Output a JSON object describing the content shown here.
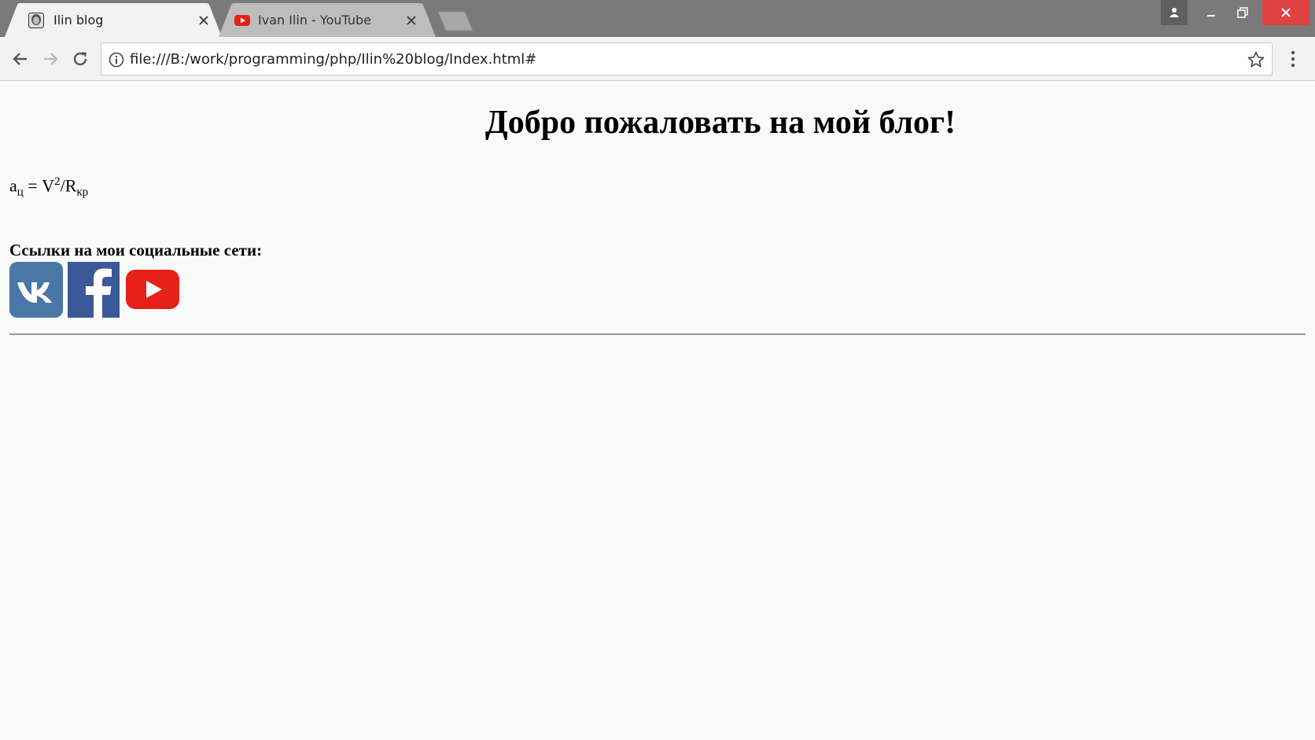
{
  "browser": {
    "tabs": [
      {
        "title": "Ilin blog",
        "active": true,
        "favicon": "user-avatar-icon"
      },
      {
        "title": "Ivan Ilin - YouTube",
        "active": false,
        "favicon": "youtube-icon"
      }
    ],
    "address_bar": {
      "url": "file:///B:/work/programming/php/Ilin%20blog/Index.html#"
    },
    "window_controls": [
      "profile-icon",
      "minimize-icon",
      "restore-icon",
      "close-icon"
    ]
  },
  "page": {
    "title": "Добро пожаловать на мой блог!",
    "formula": {
      "lhs": "a",
      "lhs_sub": "ц",
      "eq": " = V",
      "sup": "2",
      "mid": "/R",
      "rhs_sub": "кр"
    },
    "social": {
      "heading": "Ссылки на мои социальные сети:",
      "links": [
        {
          "name": "vk",
          "color": "#4a76a8"
        },
        {
          "name": "facebook",
          "color": "#3b5998"
        },
        {
          "name": "youtube",
          "color": "#e62117"
        }
      ]
    }
  }
}
